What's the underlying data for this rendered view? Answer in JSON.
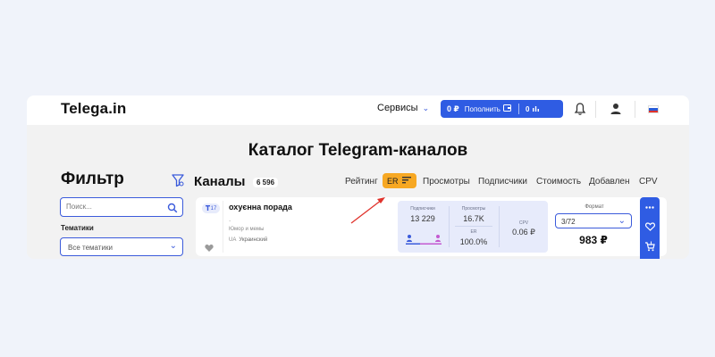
{
  "header": {
    "logo": "Telega.in",
    "services_label": "Сервисы",
    "balance": "0 ₽",
    "topup_label": "Пополнить",
    "counter": "0"
  },
  "page_title": "Каталог Telegram-каналов",
  "filter": {
    "title": "Фильтр",
    "search_placeholder": "Поиск...",
    "topics_label": "Тематики",
    "topics_value": "Все тематики"
  },
  "channels": {
    "title": "Каналы",
    "count": "6 596"
  },
  "sort": {
    "rating": "Рейтинг",
    "er": "ER",
    "views": "Просмотры",
    "subscribers": "Подписчики",
    "cost": "Стоимость",
    "added": "Добавлен",
    "cpv": "CPV"
  },
  "card": {
    "rank": "17",
    "name": "охуєнна порада",
    "dot": ".",
    "category": "Юмор и мемы",
    "lang_code": "UA",
    "language": "Украинский",
    "subs_label": "Подписчики",
    "subs_value": "13 229",
    "views_label": "Просмотры",
    "views_value": "16.7K",
    "er_label": "ER",
    "er_value": "100.0%",
    "cpv_label": "CPV",
    "cpv_value": "0.06 ₽",
    "format_label": "Формат",
    "format_value": "3/72",
    "price": "983 ₽"
  },
  "colors": {
    "accent": "#2f5ce3",
    "er_highlight": "#f7a823",
    "arrow": "#e0322b"
  }
}
